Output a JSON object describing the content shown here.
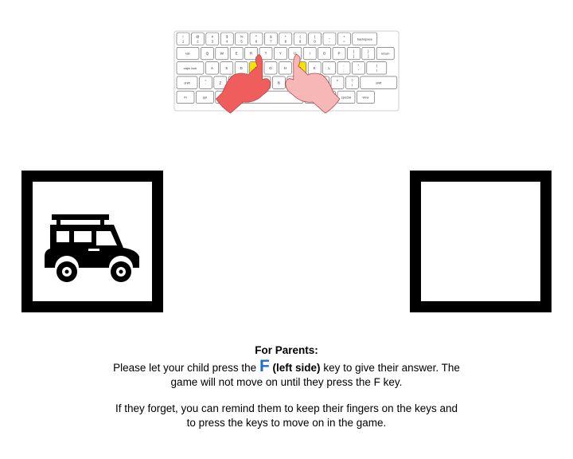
{
  "keyboard": {
    "rows": [
      [
        [
          "!",
          "1"
        ],
        [
          "@",
          "2"
        ],
        [
          "#",
          "3"
        ],
        [
          "$",
          "4"
        ],
        [
          "%",
          "5"
        ],
        [
          "^",
          "6"
        ],
        [
          "&",
          "7"
        ],
        [
          "*",
          "8"
        ],
        [
          "(",
          "9"
        ],
        [
          ")",
          "0"
        ],
        [
          "_",
          "-"
        ],
        [
          "+",
          "="
        ],
        [
          "backspace"
        ]
      ],
      [
        [
          "tab"
        ],
        [
          "Q"
        ],
        [
          "W"
        ],
        [
          "E"
        ],
        [
          "R"
        ],
        [
          "T"
        ],
        [
          "Y"
        ],
        [
          "U"
        ],
        [
          "I"
        ],
        [
          "O"
        ],
        [
          "P"
        ],
        [
          "{",
          "["
        ],
        [
          "}",
          "]"
        ],
        [
          "return"
        ]
      ],
      [
        [
          "caps lock"
        ],
        [
          "A"
        ],
        [
          "S"
        ],
        [
          "D"
        ],
        [
          "F"
        ],
        [
          "G"
        ],
        [
          "H"
        ],
        [
          "J"
        ],
        [
          "K"
        ],
        [
          "L"
        ],
        [
          ":",
          ";"
        ],
        [
          "\"",
          "'"
        ],
        [
          "|",
          "\\"
        ]
      ],
      [
        [
          "shift"
        ],
        [
          "~",
          "`"
        ],
        [
          "Z"
        ],
        [
          "X"
        ],
        [
          "C"
        ],
        [
          "V"
        ],
        [
          "B"
        ],
        [
          "N"
        ],
        [
          "M"
        ],
        [
          "<",
          ","
        ],
        [
          ">",
          "."
        ],
        [
          "?",
          "/"
        ],
        [
          "shift"
        ]
      ],
      [
        [
          "fn"
        ],
        [
          "ppi"
        ],
        [
          "space"
        ],
        [
          "alt gr"
        ],
        [
          "cmd"
        ],
        [
          "special"
        ],
        [
          "view"
        ]
      ]
    ],
    "highlight_keys": [
      "F",
      "J"
    ],
    "highlight_color": "#f5e400",
    "hand_color_left": "#ef5d5d",
    "hand_color_right": "#f6b7b7"
  },
  "frames": {
    "left": {
      "icon": "jeep-icon"
    },
    "right": {
      "icon": ""
    }
  },
  "instructions": {
    "heading": "For Parents:",
    "line1_before": "Please let your child press the",
    "key_letter": "F",
    "key_note": "(left side)",
    "line1_after": "key to give their answer. The game will not move on until they press the F key.",
    "line2": "If they forget, you can remind them to keep their fingers on the keys and to press the keys to move on in the game.",
    "accent_color": "#1f6fc8"
  }
}
